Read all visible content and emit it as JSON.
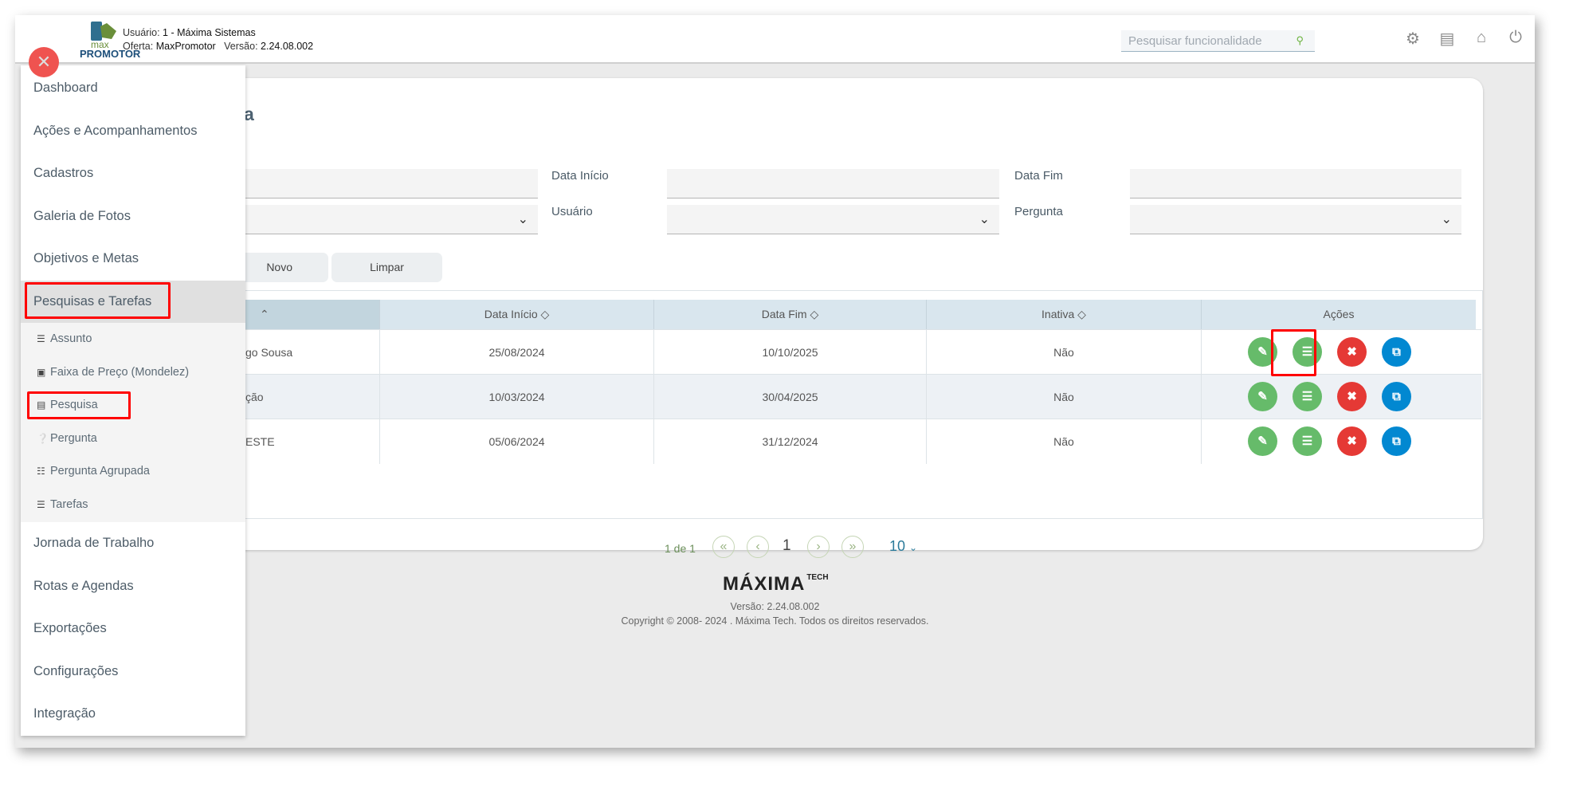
{
  "header": {
    "user_label": "Usuário:",
    "user": "1 - Máxima Sistemas",
    "offer_label": "Oferta:",
    "offer": "MaxPromotor",
    "version_label": "Versão:",
    "version": "2.24.08.002",
    "logo_top": "max",
    "logo_bottom": "PROMOTOR",
    "search_placeholder": "Pesquisar funcionalidade",
    "icons": [
      "gears-icon",
      "document-icon",
      "home-icon",
      "power-icon"
    ]
  },
  "page": {
    "title_fragment": "a"
  },
  "filters": {
    "data_inicio": "Data Início",
    "data_fim": "Data Fim",
    "usuario": "Usuário",
    "pergunta": "Pergunta"
  },
  "buttons": {
    "novo": "Novo",
    "limpar": "Limpar"
  },
  "table": {
    "columns": [
      "Data Início",
      "Data Fim",
      "Inativa",
      "Ações"
    ],
    "rows": [
      {
        "name_fragment": "go Sousa",
        "inicio": "25/08/2024",
        "fim": "10/10/2025",
        "inativa": "Não"
      },
      {
        "name_fragment": "ção",
        "inicio": "10/03/2024",
        "fim": "30/04/2025",
        "inativa": "Não"
      },
      {
        "name_fragment": "ESTE",
        "inicio": "05/06/2024",
        "fim": "31/12/2024",
        "inativa": "Não"
      }
    ]
  },
  "pagination": {
    "summary": "1 de 1",
    "current": "1",
    "page_size": "10"
  },
  "sidebar": {
    "items": [
      "Dashboard",
      "Ações e Acompanhamentos",
      "Cadastros",
      "Galeria de Fotos",
      "Objetivos e Metas",
      "Pesquisas e Tarefas"
    ],
    "subitems": [
      "Assunto",
      "Faixa de Preço (Mondelez)",
      "Pesquisa",
      "Pergunta",
      "Pergunta Agrupada",
      "Tarefas"
    ],
    "items_after": [
      "Jornada de Trabalho",
      "Rotas e Agendas",
      "Exportações",
      "Configurações",
      "Integração"
    ]
  },
  "footer": {
    "logo": "MÁXIMA TECH",
    "version": "Versão: 2.24.08.002",
    "copyright": "Copyright © 2008- 2024 . Máxima Tech. Todos os direitos reservados."
  },
  "colors": {
    "accent_green": "#66bb6a",
    "danger": "#e53935",
    "info": "#0288d1",
    "highlight": "#ff0000"
  }
}
